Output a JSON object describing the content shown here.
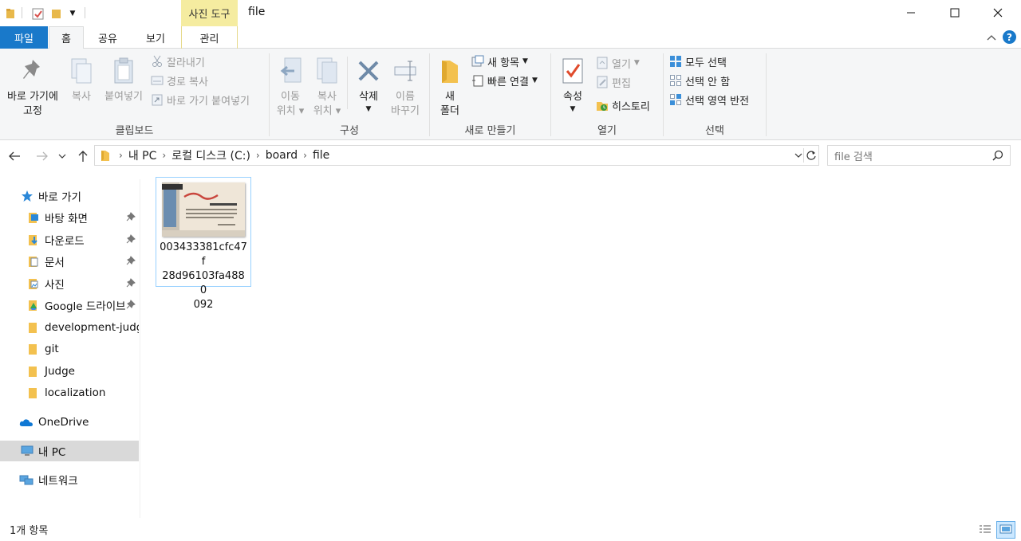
{
  "window": {
    "title": "file",
    "context_tab_header": "사진 도구"
  },
  "tabs": {
    "file": "파일",
    "home": "홈",
    "share": "공유",
    "view": "보기",
    "manage": "관리"
  },
  "ribbon": {
    "clipboard": {
      "pin": "바로 가기에\n고정",
      "pin_l1": "바로 가기에",
      "pin_l2": "고정",
      "copy": "복사",
      "paste": "붙여넣기",
      "cut": "잘라내기",
      "copy_path": "경로 복사",
      "paste_shortcut": "바로 가기 붙여넣기",
      "label": "클립보드"
    },
    "organize": {
      "move_l1": "이동",
      "move_l2": "위치",
      "copy_l1": "복사",
      "copy_l2": "위치",
      "delete": "삭제",
      "rename_l1": "이름",
      "rename_l2": "바꾸기",
      "label": "구성"
    },
    "new": {
      "folder_l1": "새",
      "folder_l2": "폴더",
      "new_item": "새 항목",
      "easy_access": "빠른 연결",
      "label": "새로 만들기"
    },
    "open": {
      "properties": "속성",
      "open": "열기",
      "edit": "편집",
      "history": "히스토리",
      "label": "열기"
    },
    "select": {
      "select_all": "모두 선택",
      "select_none": "선택 안 함",
      "invert": "선택 영역 반전",
      "label": "선택"
    }
  },
  "address": {
    "crumbs": [
      "내 PC",
      "로컬 디스크 (C:)",
      "board",
      "file"
    ]
  },
  "search": {
    "placeholder": "file 검색"
  },
  "sidebar": {
    "quick_access": "바로 가기",
    "items": [
      {
        "label": "바탕 화면",
        "pinned": true
      },
      {
        "label": "다운로드",
        "pinned": true
      },
      {
        "label": "문서",
        "pinned": true
      },
      {
        "label": "사진",
        "pinned": true
      },
      {
        "label": "Google 드라이브",
        "pinned": true
      },
      {
        "label": "development-judge",
        "pinned": false
      },
      {
        "label": "git",
        "pinned": false
      },
      {
        "label": "Judge",
        "pinned": false
      },
      {
        "label": "localization",
        "pinned": false
      }
    ],
    "onedrive": "OneDrive",
    "thispc": "내 PC",
    "network": "네트워크"
  },
  "files": [
    {
      "name": "003433381cfc47f28d96103fa4880092",
      "name_l1": "003433381cfc47f",
      "name_l2": "28d96103fa4880",
      "name_l3": "092"
    }
  ],
  "status": {
    "count": "1개 항목"
  },
  "colors": {
    "accent": "#1979ca",
    "context": "#f5eca0",
    "ribbon_bg": "#f5f6f7",
    "selection_border": "#99d1ff"
  }
}
